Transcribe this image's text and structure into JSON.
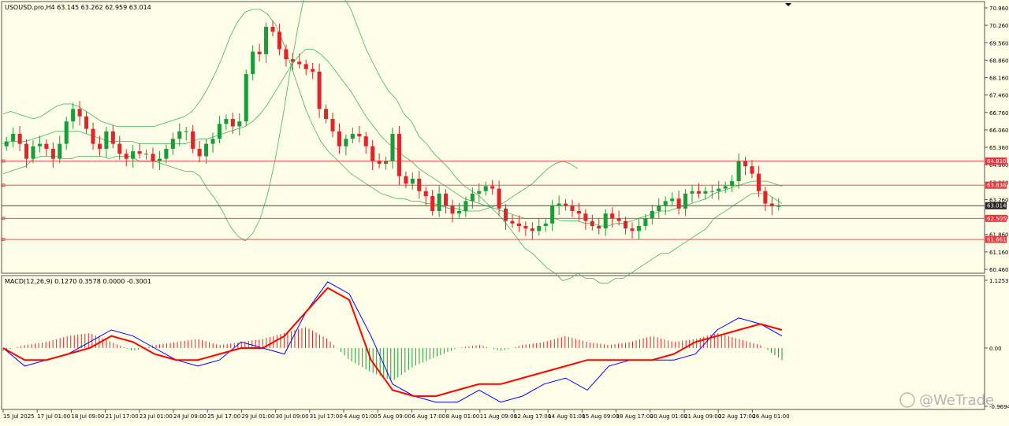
{
  "chart_data": [
    {
      "type": "candlestick",
      "symbol_line": "USOUSD.pro,H4  63.145 63.262 62.959 63.014",
      "y_ticks": [
        "70.960",
        "70.260",
        "69.560",
        "68.860",
        "68.160",
        "67.460",
        "66.760",
        "66.060",
        "65.360",
        "64.660",
        "63.960",
        "63.260",
        "62.560",
        "61.860",
        "61.160",
        "60.460"
      ],
      "ylim": [
        60.46,
        70.96
      ],
      "horizontal_lines": [
        {
          "value": 64.81,
          "label": "64.810"
        },
        {
          "value": 63.838,
          "label": "63.838"
        },
        {
          "value": 62.505,
          "label": "62.505"
        },
        {
          "value": 61.661,
          "label": "61.661"
        }
      ],
      "current_price": {
        "value": 63.014,
        "label": "63.014"
      },
      "candle_closes": [
        65.6,
        65.9,
        65.5,
        64.9,
        65.4,
        65.5,
        65.3,
        64.9,
        65.5,
        66.4,
        66.9,
        66.6,
        66.1,
        65.5,
        65.3,
        66.0,
        65.5,
        65.1,
        64.9,
        65.2,
        65.1,
        65.1,
        64.8,
        64.9,
        65.3,
        65.7,
        66.0,
        66.0,
        65.3,
        65.0,
        65.5,
        65.7,
        66.3,
        66.5,
        66.2,
        66.4,
        68.3,
        69.2,
        69.1,
        70.2,
        70.0,
        69.3,
        68.9,
        68.8,
        68.7,
        68.5,
        68.4,
        66.9,
        66.5,
        66.0,
        65.4,
        65.7,
        65.9,
        65.8,
        65.4,
        64.8,
        64.7,
        64.8,
        65.9,
        64.2,
        63.9,
        64.1,
        63.6,
        63.4,
        62.8,
        63.5,
        63.0,
        62.7,
        62.8,
        63.2,
        63.5,
        63.6,
        63.8,
        63.7,
        62.9,
        62.4,
        62.3,
        62.2,
        62.1,
        62.0,
        62.2,
        62.3,
        63.0,
        63.1,
        63.0,
        62.8,
        62.7,
        62.4,
        62.2,
        62.1,
        62.7,
        62.5,
        62.4,
        62.1,
        62.0,
        62.2,
        62.5,
        62.8,
        63.0,
        63.2,
        63.3,
        62.9,
        63.5,
        63.6,
        63.5,
        63.6,
        63.6,
        63.7,
        63.8,
        64.0,
        64.8,
        64.6,
        64.3,
        63.6,
        63.1,
        63.0,
        63.0
      ],
      "bollinger": {
        "middle": [
          65.5,
          65.6,
          65.6,
          65.6,
          65.7,
          65.8,
          65.9,
          66.0,
          66.0,
          66.0,
          66.0,
          65.9,
          65.8,
          65.7,
          65.6,
          65.6,
          65.6,
          65.6,
          65.5,
          65.5,
          65.5,
          65.5,
          65.5,
          65.5,
          65.5,
          65.6,
          65.7,
          65.7,
          65.8,
          65.9,
          66.0,
          66.1,
          66.2,
          66.4,
          66.7,
          67.1,
          67.6,
          68.1,
          68.6,
          69.0,
          69.3,
          69.3,
          69.1,
          68.8,
          68.4,
          68.0,
          67.6,
          67.1,
          66.6,
          66.2,
          65.8,
          65.5,
          65.3,
          65.0,
          64.8,
          64.5,
          64.3,
          64.1,
          63.9,
          63.7,
          63.5,
          63.3,
          63.2,
          63.1,
          63.0,
          62.9,
          62.8,
          62.7,
          62.6,
          62.5,
          62.5,
          62.5,
          62.5,
          62.5,
          62.4,
          62.4,
          62.4,
          62.3,
          62.3,
          62.2,
          62.2,
          62.3,
          62.3,
          62.4,
          62.5,
          62.6,
          62.7,
          62.8,
          62.8,
          62.9,
          63.0,
          63.1,
          63.2,
          63.3,
          63.5,
          63.6,
          63.7,
          63.8,
          63.9,
          64.0,
          64.0,
          64.0,
          63.9,
          63.8
        ],
        "upper": [
          66.7,
          66.8,
          66.7,
          66.6,
          66.5,
          66.6,
          66.8,
          67.0,
          67.1,
          67.1,
          67.0,
          66.8,
          66.6,
          66.4,
          66.3,
          66.2,
          66.2,
          66.2,
          66.2,
          66.2,
          66.2,
          66.3,
          66.4,
          66.5,
          66.6,
          66.8,
          67.2,
          67.7,
          68.3,
          69.0,
          69.8,
          70.4,
          70.8,
          70.9,
          70.9,
          70.7,
          70.3,
          69.6,
          68.7,
          67.8,
          66.9,
          66.2,
          65.6,
          65.2,
          64.9,
          64.6,
          64.3,
          64.1,
          63.9,
          63.7,
          63.5,
          63.4,
          63.3,
          63.3,
          63.2,
          63.2,
          63.1,
          63.1,
          63.0,
          62.9,
          62.9,
          62.8,
          62.8,
          62.8,
          62.9,
          63.0,
          63.1,
          63.3,
          63.5,
          63.7,
          63.9,
          64.2,
          64.5,
          64.7,
          64.8,
          64.7,
          64.5
        ]
      }
    },
    {
      "type": "macd",
      "label": "MACD(12,26,9) 0.1270 0.3578 0.0000 -0.3001",
      "y_ticks": [
        "1.1253",
        "0.00",
        "-0.9694"
      ],
      "ylim": [
        -0.9694,
        1.1253
      ],
      "series": [
        {
          "role": "macd-line",
          "color": "#0000ff",
          "values": [
            0.0,
            -0.3,
            -0.2,
            -0.1,
            0.1,
            0.3,
            0.2,
            0.0,
            -0.2,
            -0.3,
            -0.2,
            0.1,
            0.0,
            -0.1,
            0.6,
            1.1,
            0.9,
            0.2,
            -0.6,
            -0.8,
            -0.9,
            -0.9,
            -0.7,
            -0.9,
            -0.8,
            -0.6,
            -0.5,
            -0.7,
            -0.3,
            -0.2,
            -0.2,
            -0.2,
            -0.1,
            0.3,
            0.5,
            0.4,
            0.2
          ]
        },
        {
          "role": "signal-line",
          "color": "#ff0000",
          "values": [
            0.0,
            -0.2,
            -0.2,
            -0.1,
            0.0,
            0.2,
            0.1,
            -0.1,
            -0.2,
            -0.2,
            -0.1,
            0.0,
            0.0,
            0.2,
            0.6,
            1.0,
            0.8,
            -0.2,
            -0.7,
            -0.8,
            -0.8,
            -0.7,
            -0.6,
            -0.6,
            -0.5,
            -0.4,
            -0.3,
            -0.2,
            -0.2,
            -0.2,
            -0.2,
            -0.1,
            0.1,
            0.2,
            0.3,
            0.4,
            0.3
          ]
        },
        {
          "role": "histogram",
          "values": [
            -0.05,
            0.05,
            0.1,
            0.2,
            0.25,
            0.1,
            -0.05,
            0.05,
            0.1,
            0.15,
            0.05,
            0.1,
            0.15,
            0.25,
            0.35,
            0.15,
            -0.2,
            -0.4,
            -0.55,
            -0.3,
            -0.15,
            0.0,
            0.05,
            -0.05,
            0.05,
            0.1,
            0.2,
            0.1,
            0.05,
            0.1,
            0.2,
            0.1,
            0.15,
            0.25,
            0.15,
            0.05,
            -0.2
          ]
        }
      ]
    }
  ],
  "x_ticks": [
    "15 Jul 2025",
    "17 Jul 01:00",
    "18 Jul 09:00",
    "21 Jul 17:00",
    "23 Jul 01:00",
    "24 Jul 09:00",
    "25 Jul 17:00",
    "29 Jul 01:00",
    "30 Jul 09:00",
    "31 Jul 17:00",
    "4 Aug 01:00",
    "5 Aug 09:00",
    "6 Aug 17:00",
    "8 Aug 01:00",
    "11 Aug 09:00",
    "12 Aug 17:00",
    "14 Aug 01:00",
    "15 Aug 09:00",
    "18 Aug 17:00",
    "20 Aug 01:00",
    "21 Aug 09:00",
    "22 Aug 17:00",
    "26 Aug 01:00"
  ],
  "watermark": "@WeTrade",
  "colors": {
    "background": "#fefde8",
    "bull": "#1a9c3a",
    "bear": "#e0242a",
    "bands": "#3cb55a",
    "level_line": "#e8383d",
    "price_line": "#444444",
    "macd_hist_pos": "#e0242a",
    "macd_hist_neg": "#1a9c3a"
  }
}
